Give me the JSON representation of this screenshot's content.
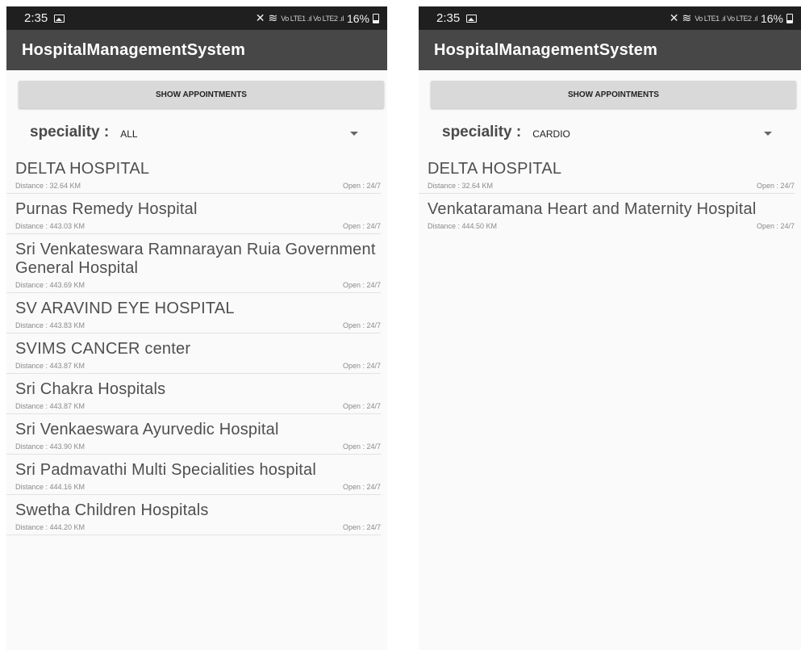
{
  "screens": [
    {
      "status": {
        "time": "2:35",
        "network": "Vo LTE1 .ıl Vo LTE2 .ıl",
        "battery": "16%"
      },
      "app_title": "HospitalManagementSystem",
      "show_button": "SHOW APPOINTMENTS",
      "speciality": {
        "label": "speciality :",
        "value": "ALL"
      },
      "hospitals": [
        {
          "name": "DELTA HOSPITAL",
          "distance": "Distance : 32.64 KM",
          "open": "Open : 24/7"
        },
        {
          "name": "Purnas Remedy Hospital",
          "distance": "Distance : 443.03 KM",
          "open": "Open : 24/7"
        },
        {
          "name": "Sri Venkateswara Ramnarayan Ruia Government  General Hospital",
          "distance": "Distance : 443.69 KM",
          "open": "Open : 24/7"
        },
        {
          "name": "SV ARAVIND EYE HOSPITAL",
          "distance": "Distance : 443.83 KM",
          "open": "Open : 24/7"
        },
        {
          "name": "SVIMS CANCER center",
          "distance": "Distance : 443.87 KM",
          "open": "Open : 24/7"
        },
        {
          "name": "Sri Chakra Hospitals",
          "distance": "Distance : 443.87 KM",
          "open": "Open : 24/7"
        },
        {
          "name": "Sri Venkaeswara Ayurvedic Hospital",
          "distance": "Distance : 443.90 KM",
          "open": "Open : 24/7"
        },
        {
          "name": "Sri Padmavathi Multi Specialities hospital",
          "distance": "Distance : 444.16 KM",
          "open": "Open : 24/7"
        },
        {
          "name": "Swetha Children Hospitals",
          "distance": "Distance : 444.20 KM",
          "open": "Open : 24/7"
        }
      ]
    },
    {
      "status": {
        "time": "2:35",
        "network": "Vo LTE1 .ıl Vo LTE2 .ıl",
        "battery": "16%"
      },
      "app_title": "HospitalManagementSystem",
      "show_button": "SHOW APPOINTMENTS",
      "speciality": {
        "label": "speciality :",
        "value": "CARDIO"
      },
      "hospitals": [
        {
          "name": "DELTA HOSPITAL",
          "distance": "Distance : 32.64 KM",
          "open": "Open : 24/7"
        },
        {
          "name": "Venkataramana Heart and Maternity Hospital",
          "distance": "Distance : 444.50 KM",
          "open": "Open : 24/7"
        }
      ]
    }
  ]
}
